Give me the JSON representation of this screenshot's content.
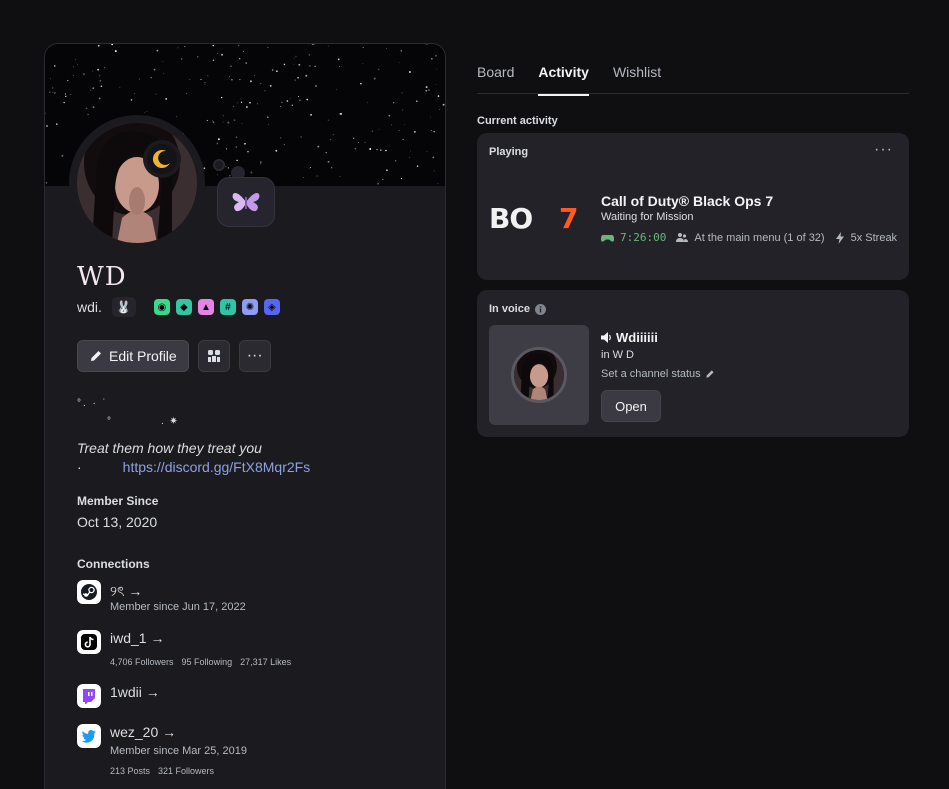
{
  "profile": {
    "display_name": "WD",
    "username": "wdi.",
    "pronoun_badge": "🐰",
    "badges": [
      {
        "icon": "nitro-badge-icon",
        "color": "#3dd68c",
        "glyph": "◉"
      },
      {
        "icon": "hypesquad-badge-icon",
        "color": "#34c5a1",
        "glyph": "◆"
      },
      {
        "icon": "triangle-badge-icon",
        "color": "#e583e6",
        "glyph": "▲"
      },
      {
        "icon": "hashtag-badge-icon",
        "color": "#2ec4a5",
        "glyph": "#"
      },
      {
        "icon": "boost-badge-icon",
        "color": "#8f9cf7",
        "glyph": "✺"
      },
      {
        "icon": "quest-badge-icon",
        "color": "#5865f2",
        "glyph": "◈"
      }
    ],
    "edit_profile_label": "Edit Profile",
    "bio_line1": "°.  ·  ˙",
    "bio_line2": "°                  .  ✷",
    "bio_italic": "Treat them how they treat you",
    "bio_dot": "·",
    "bio_link": "https://discord.gg/FtX8Mqr2Fs",
    "member_since_title": "Member Since",
    "member_since_date": "Oct 13, 2020",
    "connections_title": "Connections",
    "connections": [
      {
        "icon": "steam-icon",
        "name": "୨ৎ →",
        "sub": "Member since Jun 17, 2022"
      },
      {
        "icon": "tiktok-icon",
        "name": "iwd_1 →",
        "stats": [
          "4,706 Followers",
          "95 Following",
          "27,317 Likes"
        ]
      },
      {
        "icon": "twitch-icon",
        "name": "1wdii →"
      },
      {
        "icon": "twitter-icon",
        "name": "wez_20 →",
        "sub": "Member since Mar 25, 2019",
        "stats": [
          "213 Posts",
          "321 Followers"
        ]
      }
    ]
  },
  "tabs": [
    {
      "label": "Board",
      "active": false
    },
    {
      "label": "Activity",
      "active": true
    },
    {
      "label": "Wishlist",
      "active": false
    }
  ],
  "activity": {
    "section_title": "Current activity",
    "playing_label": "Playing",
    "more_label": "···",
    "game_logo_text": "BO7",
    "game_title": "Call of Duty® Black Ops 7",
    "game_state": "Waiting for Mission",
    "timer": "7:26:00",
    "detail": "At the main menu (1 of 32)",
    "streak": "5x Streak"
  },
  "voice": {
    "label": "In voice",
    "user": "Wdiiiiii",
    "channel": "in W D",
    "status_prompt": "Set a channel status",
    "open_label": "Open"
  }
}
